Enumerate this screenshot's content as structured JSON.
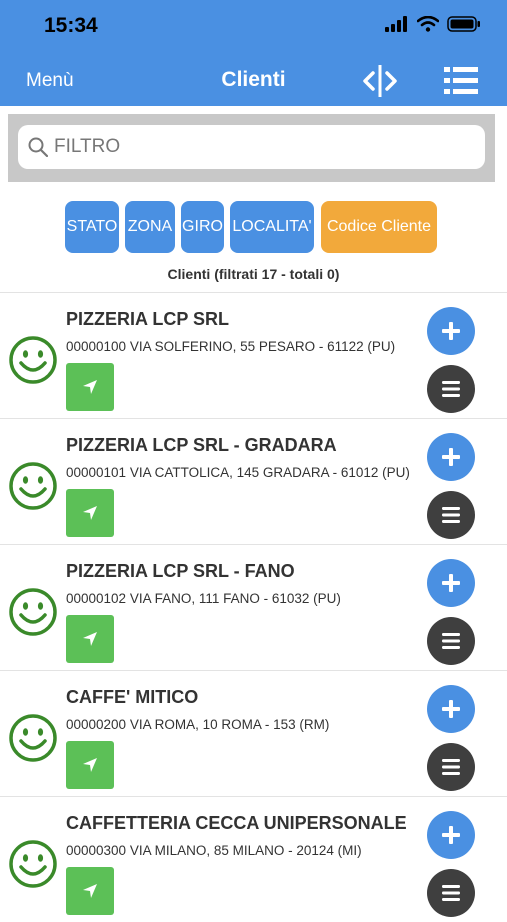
{
  "status_bar": {
    "time": "15:34"
  },
  "nav": {
    "menu_label": "Menù",
    "title": "Clienti"
  },
  "search": {
    "placeholder": "FILTRO"
  },
  "filters": [
    "STATO",
    "ZONA",
    "GIRO",
    "LOCALITA'",
    "Codice Cliente"
  ],
  "summary": "Clienti  (filtrati 17 - totali 0)",
  "clients": [
    {
      "name": "PIZZERIA LCP  SRL",
      "address": "00000100 VIA SOLFERINO, 55 PESARO - 61122 (PU)"
    },
    {
      "name": "PIZZERIA LCP SRL - GRADARA",
      "address": "00000101 VIA CATTOLICA, 145 GRADARA - 61012 (PU)"
    },
    {
      "name": "PIZZERIA LCP SRL - FANO",
      "address": "00000102 VIA FANO, 111 FANO - 61032 (PU)"
    },
    {
      "name": "CAFFE' MITICO",
      "address": "00000200 VIA ROMA, 10 ROMA - 153 (RM)"
    },
    {
      "name": "CAFFETTERIA CECCA UNIPERSONALE",
      "address": "00000300 VIA MILANO, 85 MILANO - 20124 (MI)"
    }
  ],
  "colors": {
    "header": "#4a90e2",
    "filter_button": "#4a90e2",
    "filter_active": "#f2a93b",
    "nav_button": "#5cc057",
    "smiley": "#3a8a2a",
    "menu_button": "#3f3f3f"
  },
  "icons": {
    "search": "search-icon",
    "split": "split-view-icon",
    "list": "list-menu-icon",
    "status": "smiley-icon",
    "navigate": "navigation-arrow-icon",
    "add": "plus-icon",
    "options": "hamburger-icon"
  }
}
